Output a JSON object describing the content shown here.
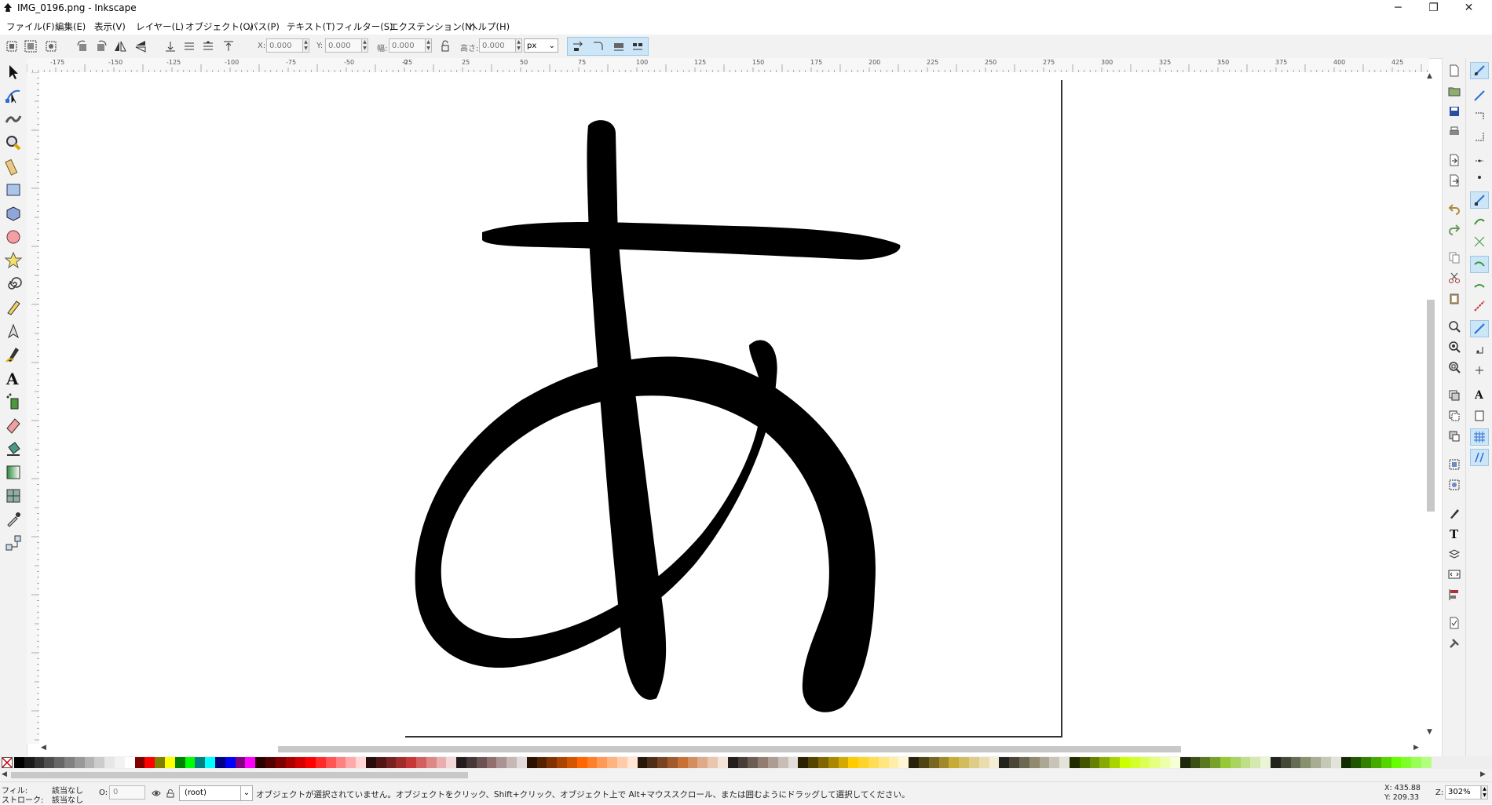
{
  "window": {
    "title": "IMG_0196.png - Inkscape",
    "minimize_label": "─",
    "maximize_label": "❐",
    "close_label": "✕"
  },
  "menubar": {
    "items": [
      {
        "label": "ファイル(F)"
      },
      {
        "label": "編集(E)"
      },
      {
        "label": "表示(V)"
      },
      {
        "label": "レイヤー(L)"
      },
      {
        "label": "オブジェクト(O)"
      },
      {
        "label": "パス(P)"
      },
      {
        "label": "テキスト(T)"
      },
      {
        "label": "フィルター(S)"
      },
      {
        "label": "エクステンション(N)"
      },
      {
        "label": "ヘルプ(H)"
      }
    ]
  },
  "toolbar": {
    "x_label": "X:",
    "x_value": "0.000",
    "y_label": "Y:",
    "y_value": "0.000",
    "w_label": "幅:",
    "w_value": "0.000",
    "h_label": "高さ:",
    "h_value": "0.000",
    "unit": "px"
  },
  "ruler": {
    "labels": [
      "-175",
      "-150",
      "-125",
      "-100",
      "-75",
      "-50",
      "-25",
      "0",
      "25",
      "50",
      "75",
      "100",
      "125",
      "150",
      "175",
      "200",
      "225",
      "250",
      "275",
      "300",
      "325",
      "350",
      "375",
      "400",
      "425"
    ]
  },
  "canvas": {
    "glyph": "あ"
  },
  "palette": {
    "colors": [
      "#000000",
      "#1a1a1a",
      "#333333",
      "#4d4d4d",
      "#666666",
      "#808080",
      "#999999",
      "#b3b3b3",
      "#cccccc",
      "#e6e6e6",
      "#f2f2f2",
      "#ffffff",
      "#800000",
      "#ff0000",
      "#808000",
      "#ffff00",
      "#008000",
      "#00ff00",
      "#008080",
      "#00ffff",
      "#000080",
      "#0000ff",
      "#800080",
      "#ff00ff",
      "#2b0000",
      "#550000",
      "#800000",
      "#aa0000",
      "#d40000",
      "#ff0000",
      "#ff2a2a",
      "#ff5555",
      "#ff8080",
      "#ffaaaa",
      "#ffd5d5",
      "#280b0b",
      "#501616",
      "#782121",
      "#a02c2c",
      "#c83737",
      "#d35f5f",
      "#de8787",
      "#e9afaf",
      "#f4d7d7",
      "#241c1c",
      "#483737",
      "#6c5353",
      "#916f6f",
      "#ac9393",
      "#c8b7b7",
      "#e3dbdb",
      "#2b1100",
      "#552200",
      "#803300",
      "#aa4400",
      "#d45500",
      "#ff6600",
      "#ff7f2a",
      "#ff9955",
      "#ffb380",
      "#ffccaa",
      "#ffe6d5",
      "#28170b",
      "#502d16",
      "#784421",
      "#a05a2c",
      "#c87137",
      "#d38d5f",
      "#deaa87",
      "#e9c6af",
      "#f4e3d7",
      "#241f1c",
      "#483e37",
      "#6c5d53",
      "#917c6f",
      "#ac9d93",
      "#c8beb7",
      "#e3dedb",
      "#2b2200",
      "#554400",
      "#806600",
      "#aa8800",
      "#d4aa00",
      "#ffcc00",
      "#ffd42a",
      "#ffdd55",
      "#ffe680",
      "#ffeeaa",
      "#fff6d5",
      "#28220b",
      "#504416",
      "#786721",
      "#a0892c",
      "#c8ab37",
      "#d3bc5f",
      "#decd87",
      "#e9ddaf",
      "#f4eed7",
      "#24221c",
      "#484537",
      "#6c6753",
      "#918a6f",
      "#aca793",
      "#c8c4b7",
      "#e3e2db",
      "#222b00",
      "#445500",
      "#668000",
      "#88aa00",
      "#aad400",
      "#ccff00",
      "#d4ff2a",
      "#ddff55",
      "#e5ff80",
      "#eeffaa",
      "#f6ffd5",
      "#1e280b",
      "#3c5016",
      "#5a7821",
      "#78a02c",
      "#96c837",
      "#abd35f",
      "#c0de87",
      "#d5e9af",
      "#eaf4d7",
      "#22241c",
      "#444837",
      "#666c53",
      "#88916f",
      "#a7ac93",
      "#c4c8b7",
      "#e2e3db",
      "#112b00",
      "#225500",
      "#338000",
      "#44aa00",
      "#55d400",
      "#66ff00",
      "#7fff2a",
      "#99ff55",
      "#b3ff80"
    ]
  },
  "status": {
    "fill_label": "フィル:",
    "fill_value": "該当なし",
    "stroke_label": "ストローク:",
    "stroke_value": "該当なし",
    "opacity_label": "O:",
    "opacity_value": "0",
    "layer": "(root)",
    "message": "オブジェクトが選択されていません。オブジェクトをクリック、Shift+クリック、オブジェクト上で Alt+マウススクロール、または囲むようにドラッグして選択してください。",
    "x_coord": "X: 435.88",
    "y_coord": "Y: 209.33",
    "zoom_label": "Z:",
    "zoom_value": "302%"
  }
}
